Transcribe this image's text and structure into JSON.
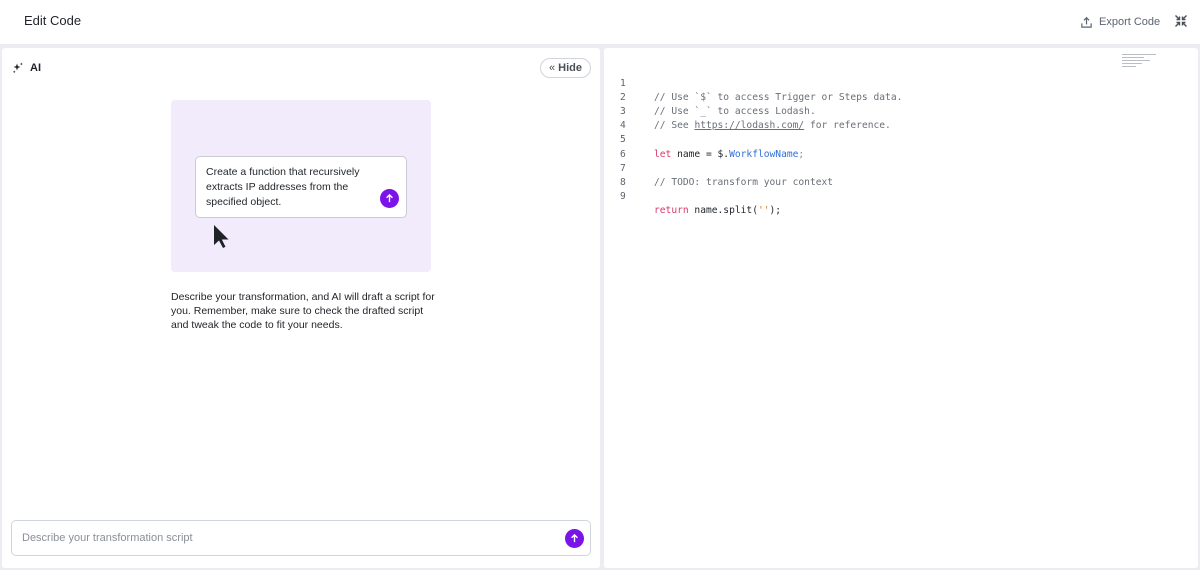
{
  "header": {
    "title": "Edit Code",
    "export_label": "Export Code"
  },
  "ai_panel": {
    "label": "AI",
    "hide_label": "Hide",
    "demo_prompt": "Create a function that recursively extracts IP addresses from the specified object.",
    "description": "Describe your transformation, and AI will draft a script for you. Remember, make sure to check the drafted script and tweak the code to fit your needs.",
    "input_placeholder": "Describe your transformation script",
    "input_value": ""
  },
  "editor": {
    "line_numbers": [
      "1",
      "2",
      "3",
      "4",
      "5",
      "6",
      "7",
      "8",
      "9"
    ],
    "code": {
      "line1": "// Use `$` to access Trigger or Steps data.",
      "line2": "// Use `_` to access Lodash.",
      "line3_pre": "// See ",
      "line3_link": "https://lodash.com/",
      "line3_post": " for reference.",
      "line5_kw": "let",
      "line5_name": " name = $.",
      "line5_prop": "WorkflowName",
      "line5_end": ";",
      "line7": "// TODO: transform your context",
      "line9_kw": "return",
      "line9_call": " name.split(",
      "line9_str": "''",
      "line9_end": ");"
    }
  },
  "colors": {
    "accent": "#7a14e8",
    "illustration_bg": "#f1ebfb",
    "keyword": "#d73a6a",
    "property": "#2f6fd6",
    "string": "#d07a1a"
  },
  "icons": {
    "export": "export-icon",
    "collapse": "collapse-arrows-icon",
    "ai": "sparkle-icon",
    "hide": "chevrons-left-icon",
    "send": "arrow-up-icon",
    "cursor": "mouse-pointer-icon"
  }
}
